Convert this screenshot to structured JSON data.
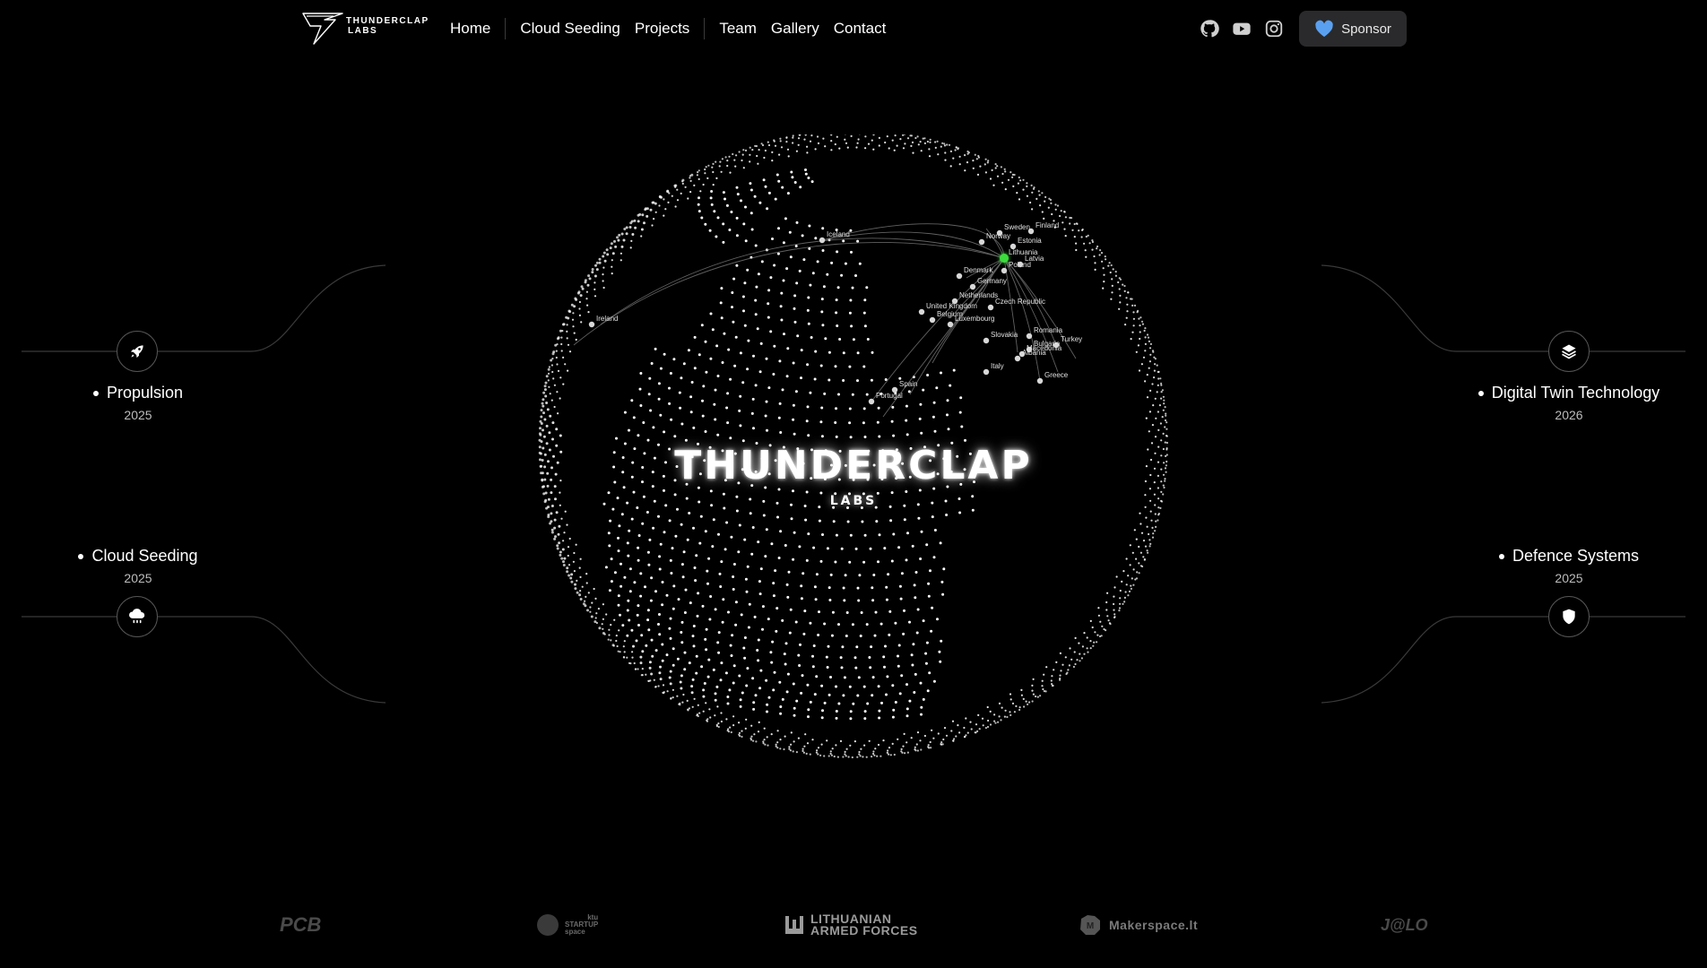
{
  "brand": {
    "logo_line1": "THUNDERCLAP",
    "logo_line2": "LABS",
    "hero_title": "THUNDERCLAP",
    "hero_subtitle": "LABS"
  },
  "nav": {
    "home": "Home",
    "cloud_seeding": "Cloud Seeding",
    "projects": "Projects",
    "team": "Team",
    "gallery": "Gallery",
    "contact": "Contact"
  },
  "socials": [
    "github-icon",
    "youtube-icon",
    "instagram-icon"
  ],
  "sponsor": {
    "label": "Sponsor",
    "icon": "heart-icon",
    "icon_color": "#5aa0f0"
  },
  "topics": {
    "propulsion": {
      "title": "Propulsion",
      "year": "2025",
      "icon": "rocket-icon"
    },
    "cloud_seeding": {
      "title": "Cloud Seeding",
      "year": "2025",
      "icon": "cloud-rain-icon"
    },
    "digital_twin": {
      "title": "Digital Twin Technology",
      "year": "2026",
      "icon": "layers-icon"
    },
    "defence": {
      "title": "Defence Systems",
      "year": "2025",
      "icon": "shield-icon"
    }
  },
  "globe": {
    "labels": [
      "Iceland",
      "Denmark",
      "Germany",
      "Netherlands",
      "United Kingdom",
      "Belgium",
      "Luxembourg",
      "Czech Republic",
      "Lithuania",
      "Poland",
      "Slovakia",
      "Romania",
      "Bulgaria",
      "Macedonia",
      "Albania",
      "Turkey",
      "Italy",
      "Greece",
      "Spain",
      "Portugal",
      "Ireland",
      "Norway",
      "Sweden",
      "Finland",
      "Latvia",
      "Estonia"
    ],
    "highlight_color": "#3ddc3d"
  },
  "partners": {
    "pcb": "PCB",
    "startup_line1": "ktu",
    "startup_line2": "STARTUP",
    "startup_line3": "space",
    "laf_line1": "LITHUANIAN",
    "laf_line2": "ARMED FORCES",
    "makerspace": "Makerspace.lt",
    "jalo": "J@LO"
  }
}
